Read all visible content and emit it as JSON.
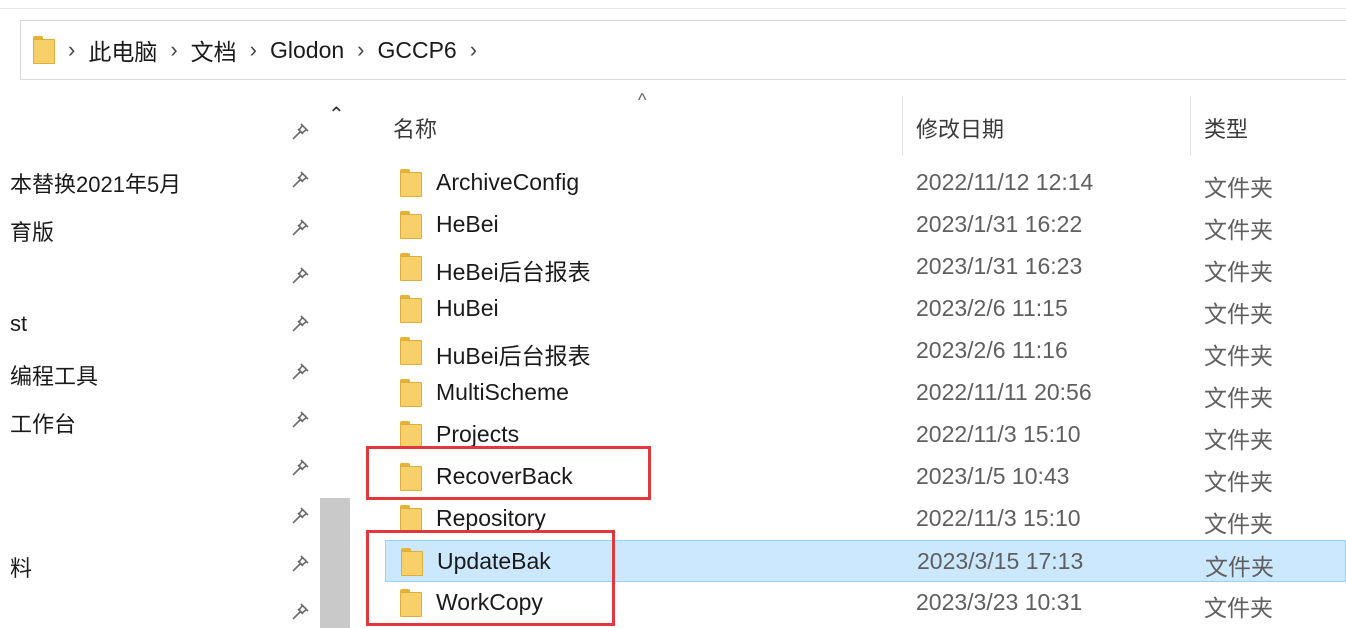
{
  "breadcrumb": {
    "items": [
      "此电脑",
      "文档",
      "Glodon",
      "GCCP6"
    ],
    "separator": "›"
  },
  "nav": {
    "items": [
      {
        "label": ""
      },
      {
        "label": "本替换2021年5月"
      },
      {
        "label": "育版"
      },
      {
        "label": ""
      },
      {
        "label": "st"
      },
      {
        "label": "编程工具"
      },
      {
        "label": "工作台"
      },
      {
        "label": ""
      },
      {
        "label": ""
      },
      {
        "label": "料"
      },
      {
        "label": ""
      }
    ],
    "scroll_up": "⌃"
  },
  "columns": {
    "name": "名称",
    "date": "修改日期",
    "type": "类型",
    "sort_indicator": "^"
  },
  "files": [
    {
      "name": "ArchiveConfig",
      "date": "2022/11/12 12:14",
      "type": "文件夹"
    },
    {
      "name": "HeBei",
      "date": "2023/1/31 16:22",
      "type": "文件夹"
    },
    {
      "name": "HeBei后台报表",
      "date": "2023/1/31 16:23",
      "type": "文件夹"
    },
    {
      "name": "HuBei",
      "date": "2023/2/6 11:15",
      "type": "文件夹"
    },
    {
      "name": "HuBei后台报表",
      "date": "2023/2/6 11:16",
      "type": "文件夹"
    },
    {
      "name": "MultiScheme",
      "date": "2022/11/11 20:56",
      "type": "文件夹"
    },
    {
      "name": "Projects",
      "date": "2022/11/3 15:10",
      "type": "文件夹"
    },
    {
      "name": "RecoverBack",
      "date": "2023/1/5 10:43",
      "type": "文件夹"
    },
    {
      "name": "Repository",
      "date": "2022/11/3 15:10",
      "type": "文件夹"
    },
    {
      "name": "UpdateBak",
      "date": "2023/3/15 17:13",
      "type": "文件夹",
      "selected": true
    },
    {
      "name": "WorkCopy",
      "date": "2023/3/23 10:31",
      "type": "文件夹"
    }
  ],
  "colors": {
    "selection": "#cce8ff",
    "highlight": "#e0383c",
    "folder": "#f7d06a"
  }
}
